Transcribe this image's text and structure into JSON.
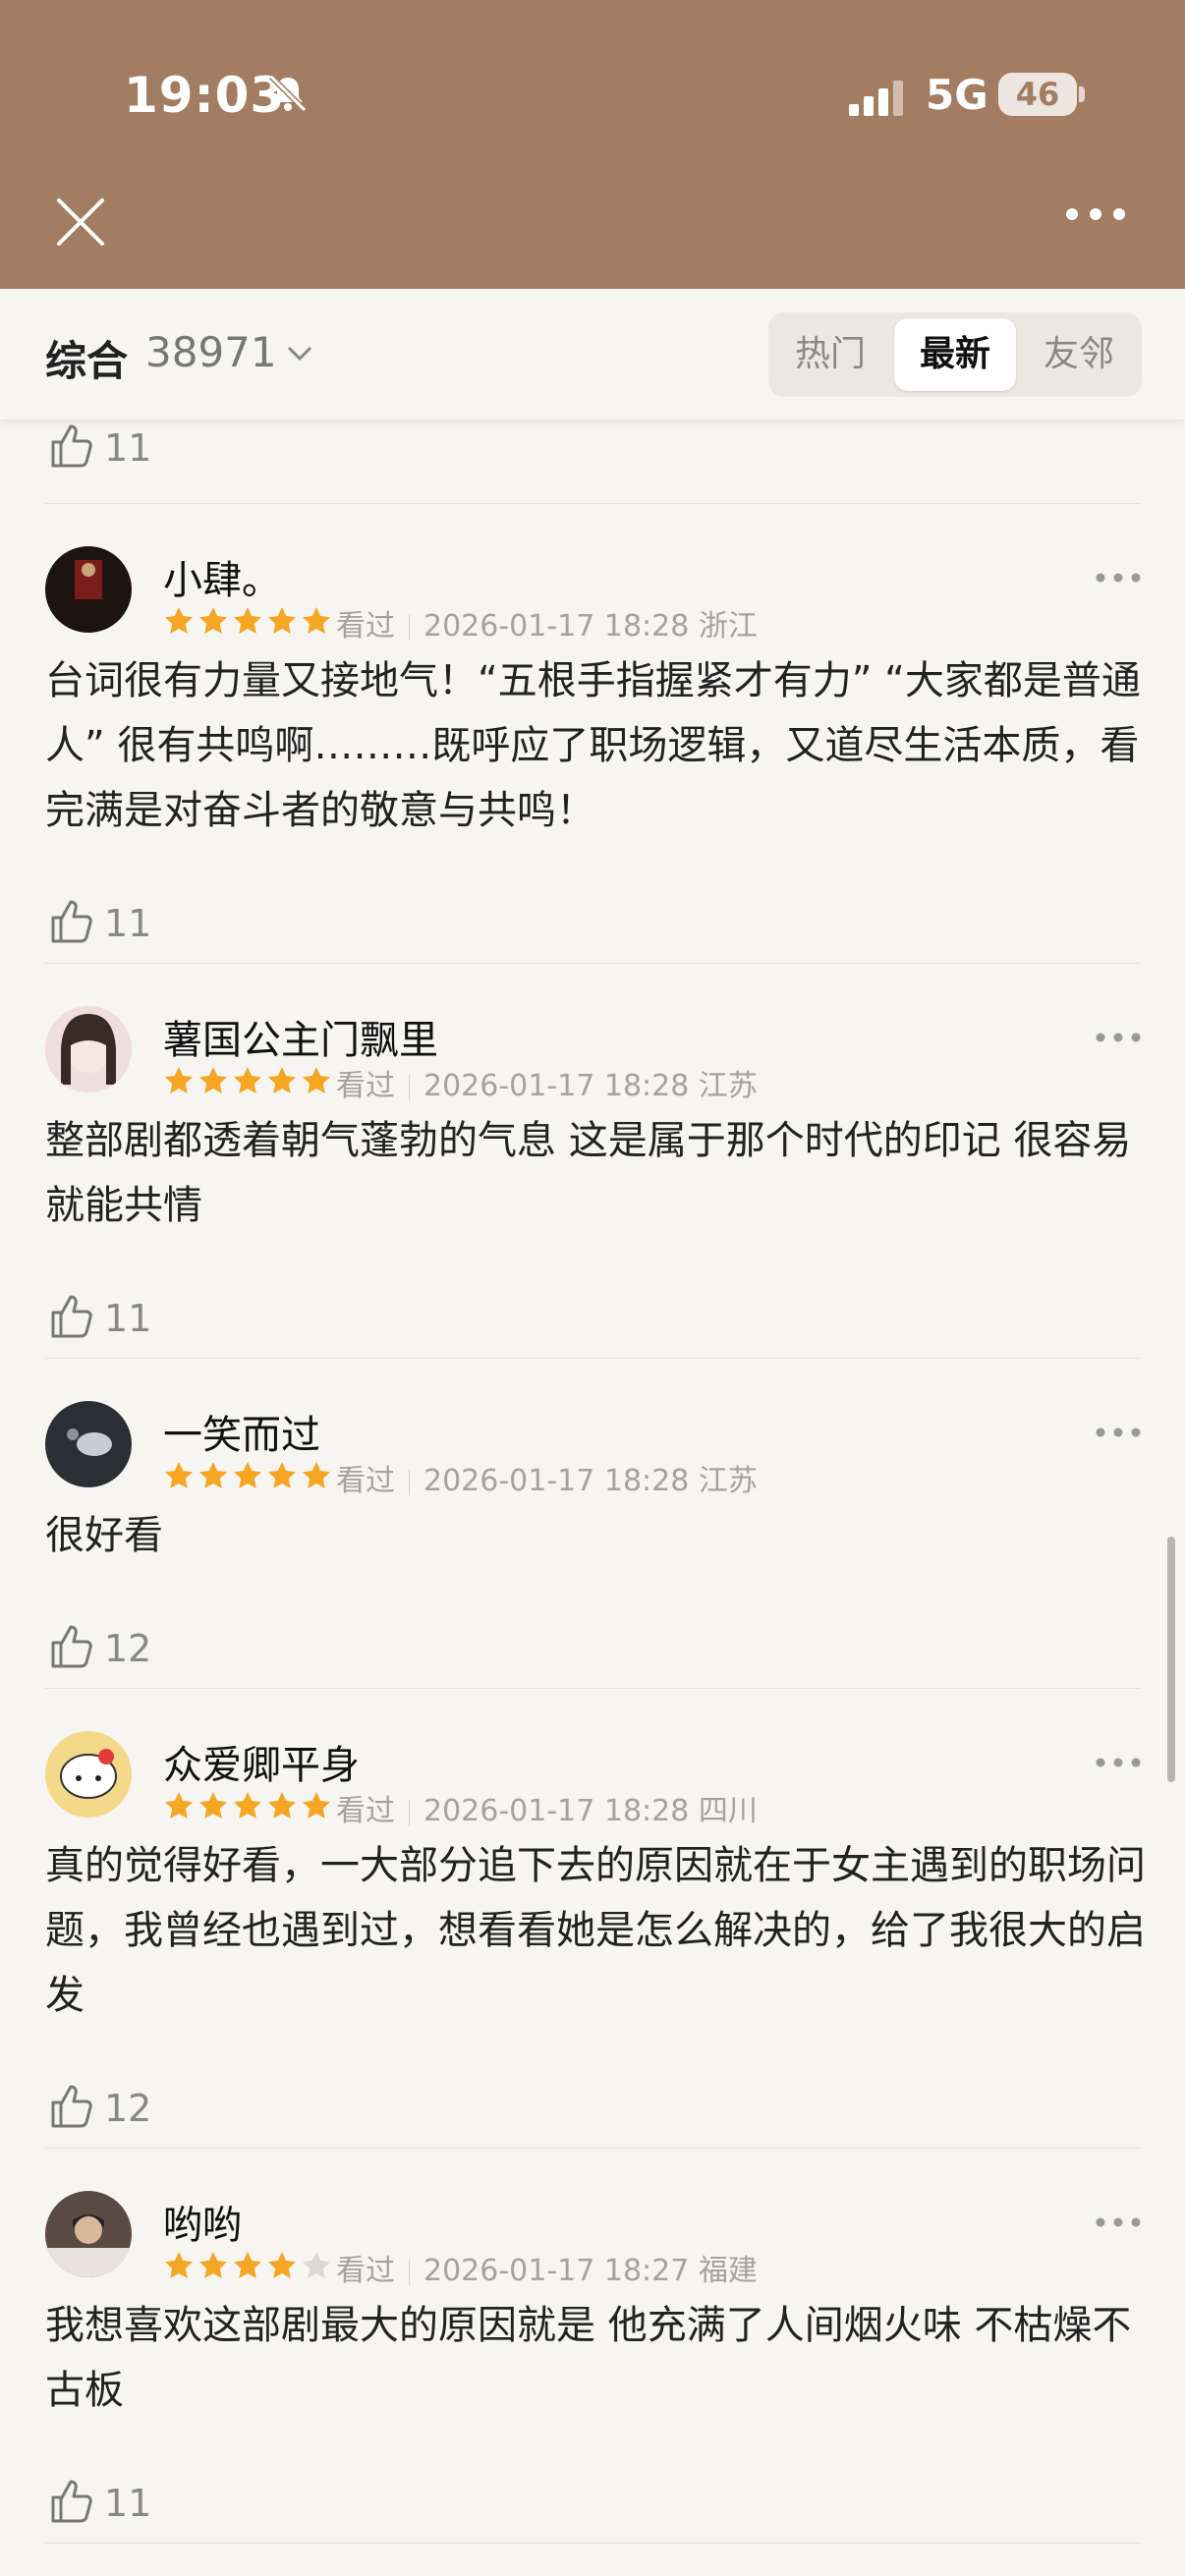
{
  "status": {
    "time": "19:03",
    "network": "5G",
    "battery": "46"
  },
  "header": {
    "close_icon": "close-icon",
    "more_icon": "more-horizontal-icon"
  },
  "filter": {
    "label": "综合",
    "count": "38971",
    "tabs": [
      {
        "label": "热门",
        "active": false
      },
      {
        "label": "最新",
        "active": true
      },
      {
        "label": "友邻",
        "active": false
      }
    ]
  },
  "top_like": {
    "count": "11"
  },
  "comments": [
    {
      "username": "小肆。",
      "rating": 5,
      "status": "看过",
      "datetime": "2026-01-17 18:28",
      "location": "浙江",
      "text": "台词很有力量又接地气！“五根手指握紧才有力” “大家都是普通人” 很有共鸣啊………既呼应了职场逻辑，又道尽生活本质，看完满是对奋斗者的敬意与共鸣！",
      "likes": "11",
      "avatar_color": "#1d1410"
    },
    {
      "username": "薯国公主门飘里",
      "rating": 5,
      "status": "看过",
      "datetime": "2026-01-17 18:28",
      "location": "江苏",
      "text": "整部剧都透着朝气蓬勃的气息 这是属于那个时代的印记 很容易就能共情",
      "likes": "11",
      "avatar_color": "#efdedc"
    },
    {
      "username": "一笑而过",
      "rating": 5,
      "status": "看过",
      "datetime": "2026-01-17 18:28",
      "location": "江苏",
      "text": "很好看",
      "likes": "12",
      "avatar_color": "#2b2e33"
    },
    {
      "username": "众爱卿平身",
      "rating": 5,
      "status": "看过",
      "datetime": "2026-01-17 18:28",
      "location": "四川",
      "text": "真的觉得好看，一大部分追下去的原因就在于女主遇到的职场问题，我曾经也遇到过，想看看她是怎么解决的，给了我很大的启发",
      "likes": "12",
      "avatar_color": "#f4d98a"
    },
    {
      "username": "哟哟",
      "rating": 4,
      "status": "看过",
      "datetime": "2026-01-17 18:27",
      "location": "福建",
      "text": "我想喜欢这部剧最大的原因就是 他充满了人间烟火味 不枯燥不古板",
      "likes": "11",
      "avatar_color": "#5a4a44"
    }
  ],
  "colors": {
    "header_bg": "#a37d62",
    "page_bg": "#f7f5f2",
    "star": "#f5a623",
    "star_empty": "#dcd8d3"
  }
}
